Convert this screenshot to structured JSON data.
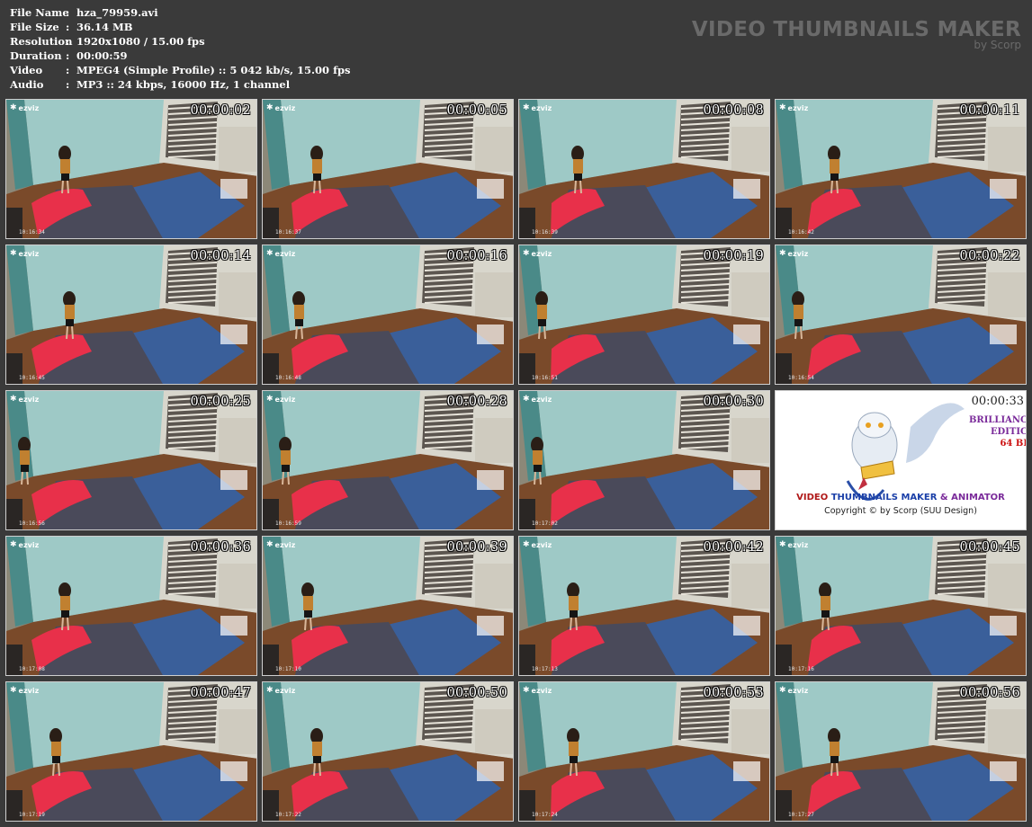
{
  "meta": [
    {
      "label": "File Name",
      "value": "hza_79959.avi"
    },
    {
      "label": "File Size",
      "value": "36.14 MB"
    },
    {
      "label": "Resolution",
      "value": "1920x1080 / 15.00 fps"
    },
    {
      "label": "Duration",
      "value": "00:00:59"
    },
    {
      "label": "Video",
      "value": "MPEG4 (Simple Profile) :: 5 042 kb/s, 15.00 fps"
    },
    {
      "label": "Audio",
      "value": "MP3 :: 24 kbps, 16000 Hz, 1 channel"
    }
  ],
  "brand": {
    "title": "VIDEO THUMBNAILS MAKER",
    "by": "by Scorp"
  },
  "camera_brand": "ezviz",
  "thumbs": [
    {
      "ts": "00:00:02",
      "clock": "10:16:34"
    },
    {
      "ts": "00:00:05",
      "clock": "10:16:37"
    },
    {
      "ts": "00:00:08",
      "clock": "10:16:39"
    },
    {
      "ts": "00:00:11",
      "clock": "10:16:42"
    },
    {
      "ts": "00:00:14",
      "clock": "10:16:45"
    },
    {
      "ts": "00:00:16",
      "clock": "10:16:48"
    },
    {
      "ts": "00:00:19",
      "clock": "10:16:51"
    },
    {
      "ts": "00:00:22",
      "clock": "10:16:54"
    },
    {
      "ts": "00:00:25",
      "clock": "10:16:56"
    },
    {
      "ts": "00:00:28",
      "clock": "10:16:59"
    },
    {
      "ts": "00:00:30",
      "clock": "10:17:02"
    },
    {
      "ts": "00:00:33",
      "clock": "",
      "logo": true
    },
    {
      "ts": "00:00:36",
      "clock": "10:17:08"
    },
    {
      "ts": "00:00:39",
      "clock": "10:17:10"
    },
    {
      "ts": "00:00:42",
      "clock": "10:17:13"
    },
    {
      "ts": "00:00:45",
      "clock": "10:17:16"
    },
    {
      "ts": "00:00:47",
      "clock": "10:17:19"
    },
    {
      "ts": "00:00:50",
      "clock": "10:17:22"
    },
    {
      "ts": "00:00:53",
      "clock": "10:17:24"
    },
    {
      "ts": "00:00:56",
      "clock": "10:17:27"
    }
  ],
  "logo_tile": {
    "line1_a": "VIDEO ",
    "line1_b": "THUMBNAILS MAKER",
    "line1_c": " & ANIMATOR",
    "line2": "Copyright © by Scorp (SUU Design)",
    "edition_1": "BRILLIANC",
    "edition_2": "EDITIC",
    "edition_3": "64 BI"
  },
  "colors": {
    "bg": "#3a3a3a",
    "brand": "#6a6a6a",
    "logo_blue": "#1a3fa8",
    "logo_red": "#b01818",
    "logo_purple": "#7a2a9a"
  }
}
